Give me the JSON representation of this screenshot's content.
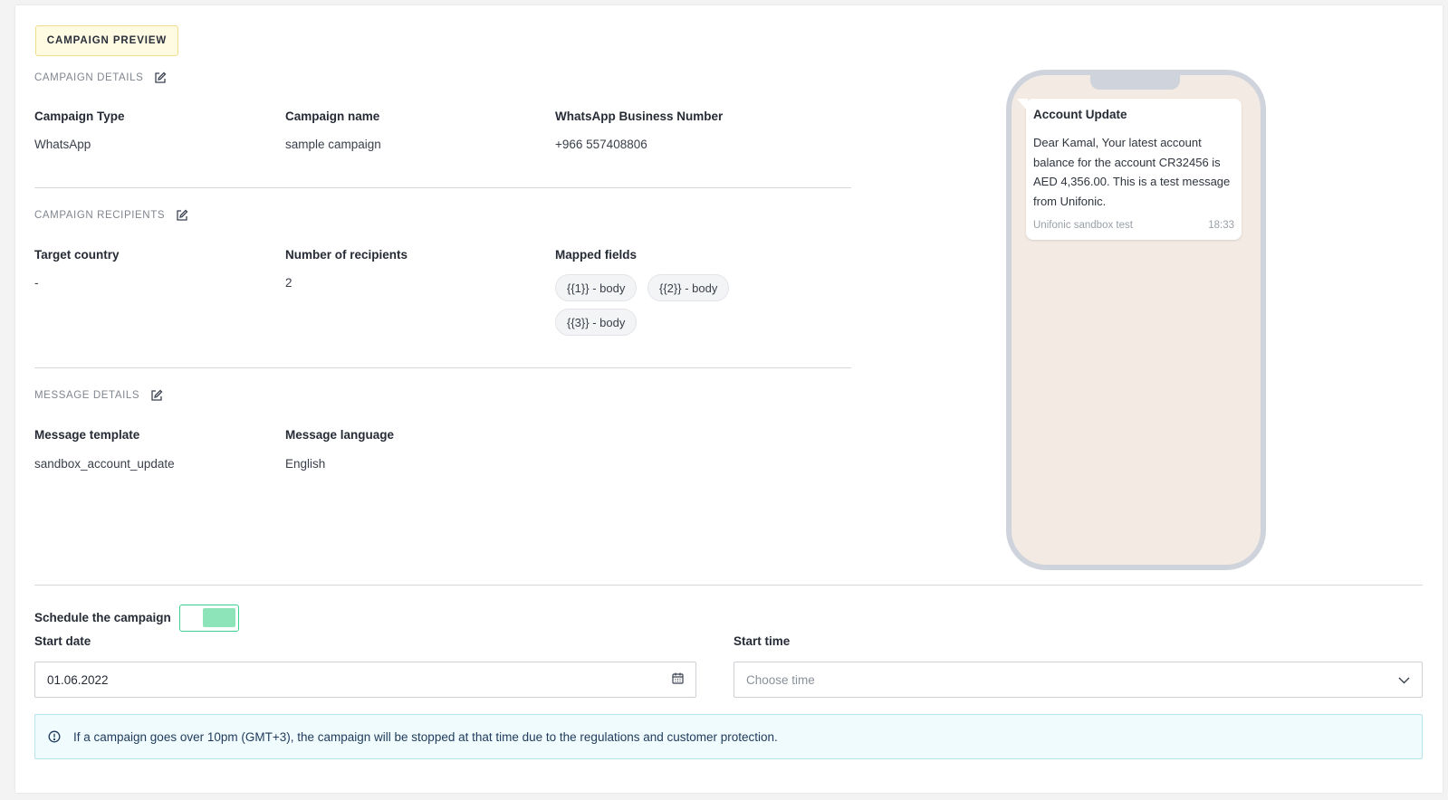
{
  "preview_badge": "CAMPAIGN PREVIEW",
  "campaign_details": {
    "title": "CAMPAIGN DETAILS",
    "fields": [
      {
        "label": "Campaign Type",
        "value": "WhatsApp"
      },
      {
        "label": "Campaign name",
        "value": "sample campaign"
      },
      {
        "label": "WhatsApp Business Number",
        "value": "+966 557408806"
      }
    ]
  },
  "campaign_recipients": {
    "title": "CAMPAIGN RECIPIENTS",
    "target_country_label": "Target country",
    "target_country_value": "-",
    "recipients_label": "Number of recipients",
    "recipients_value": "2",
    "mapped_label": "Mapped fields",
    "mapped_fields": [
      "{{1}} - body",
      "{{2}} - body",
      "{{3}} - body"
    ]
  },
  "message_details": {
    "title": "MESSAGE DETAILS",
    "template_label": "Message template",
    "template_value": "sandbox_account_update",
    "language_label": "Message language",
    "language_value": "English"
  },
  "phone_preview": {
    "title": "Account Update",
    "body": "Dear Kamal, Your latest account balance for the account CR32456 is AED 4,356.00. This is a test message from Unifonic.",
    "sender": "Unifonic sandbox test",
    "time": "18:33"
  },
  "schedule": {
    "label": "Schedule the campaign",
    "enabled": true,
    "start_date_label": "Start date",
    "start_date_value": "01.06.2022",
    "start_time_label": "Start time",
    "start_time_placeholder": "Choose time"
  },
  "notice": "If a campaign goes over 10pm (GMT+3), the campaign will be stopped at that time due to the regulations and customer protection.",
  "colors": {
    "accent_green": "#3ecf8e",
    "badge_bg": "#fffbe3",
    "info_bg": "#effbfd",
    "phone_bg": "#f3ebe3"
  }
}
